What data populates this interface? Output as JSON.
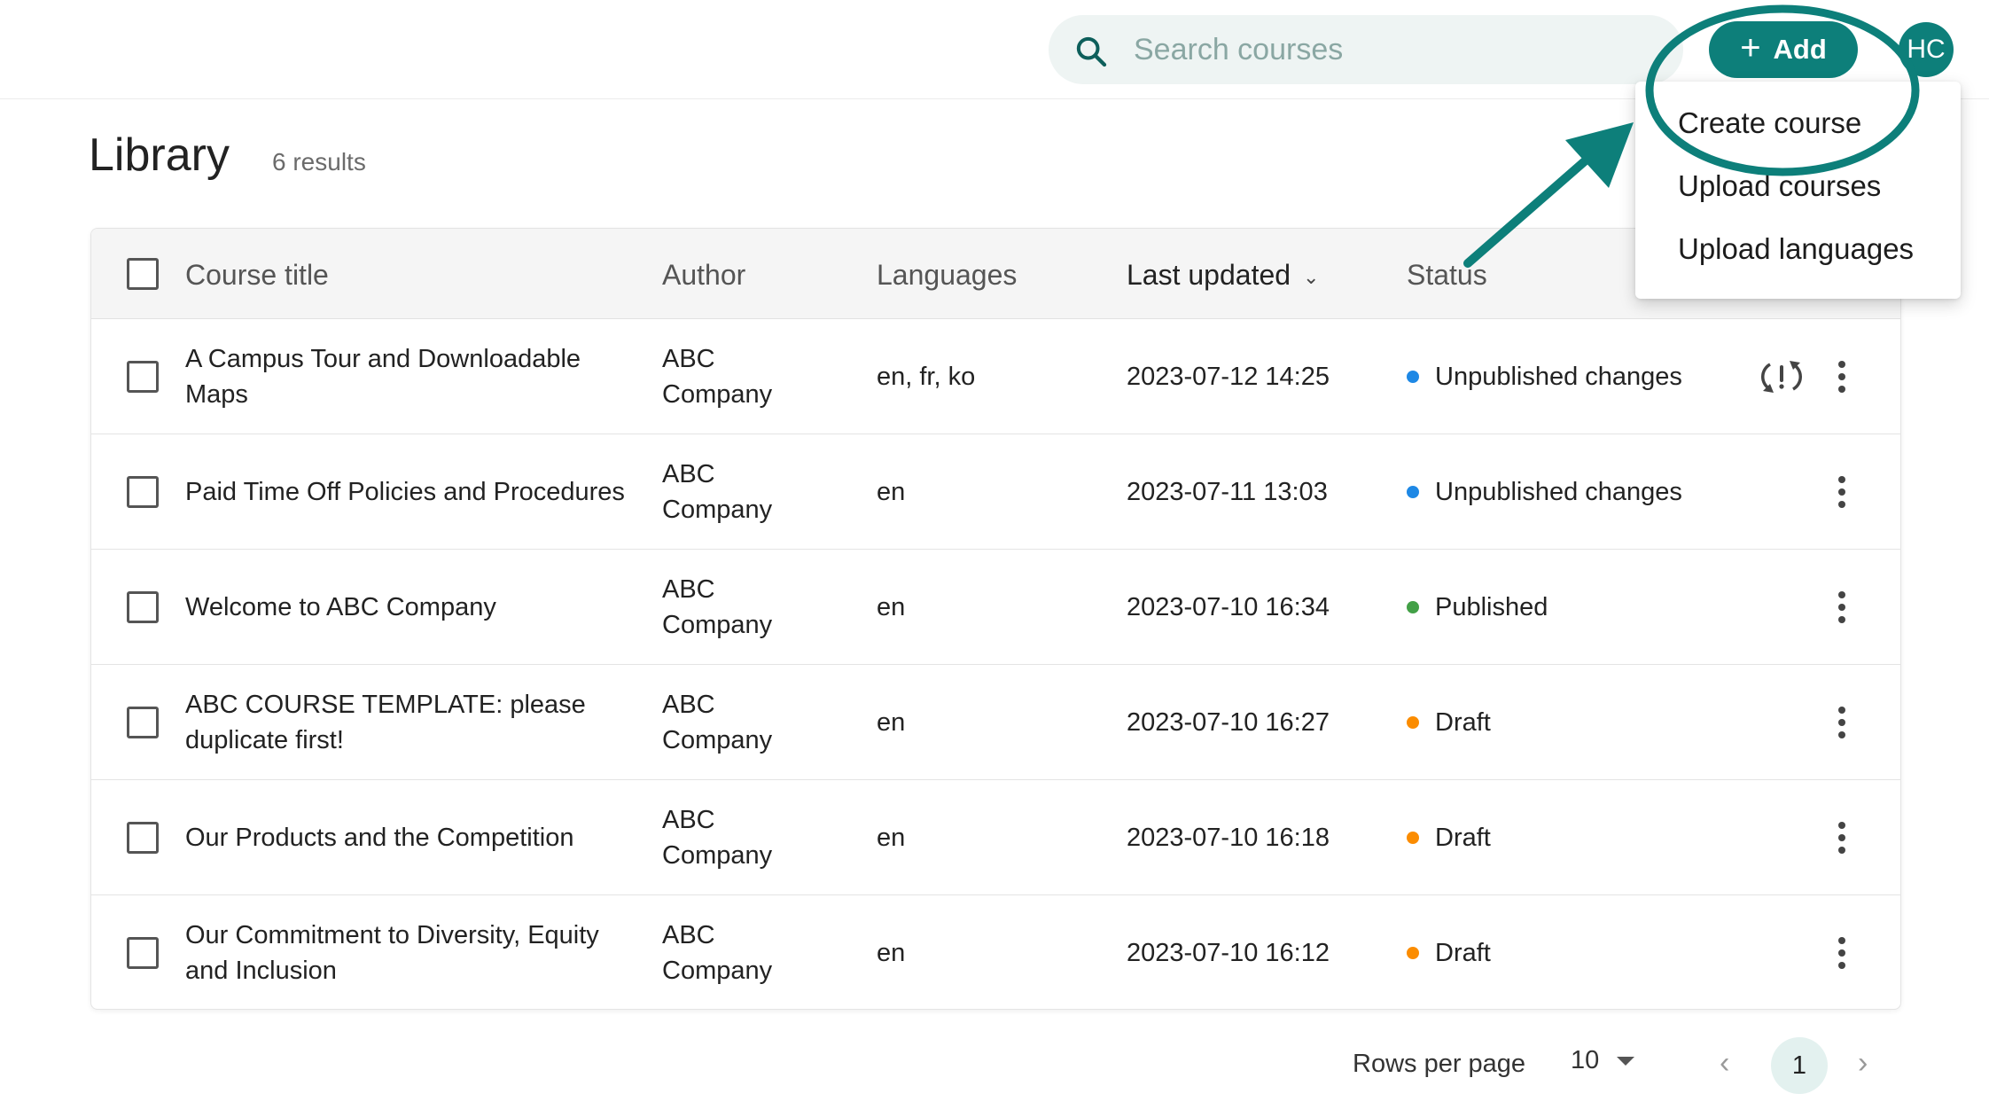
{
  "search": {
    "placeholder": "Search courses"
  },
  "header": {
    "add_label": "Add",
    "avatar_initials": "HC"
  },
  "add_menu": {
    "items": [
      "Create course",
      "Upload courses",
      "Upload languages"
    ]
  },
  "page": {
    "title": "Library",
    "results": "6 results"
  },
  "table": {
    "columns": [
      "Course title",
      "Author",
      "Languages",
      "Last updated",
      "Status"
    ],
    "rows": [
      {
        "title": "A Campus Tour and Downloadable Maps",
        "author": "ABC Company",
        "languages": "en, fr, ko",
        "updated": "2023-07-12 14:25",
        "status": "Unpublished changes",
        "status_color": "#1e88e5",
        "sync_icon": true
      },
      {
        "title": "Paid Time Off Policies and Procedures",
        "author": "ABC Company",
        "languages": "en",
        "updated": "2023-07-11 13:03",
        "status": "Unpublished changes",
        "status_color": "#1e88e5"
      },
      {
        "title": "Welcome to ABC Company",
        "author": "ABC Company",
        "languages": "en",
        "updated": "2023-07-10 16:34",
        "status": "Published",
        "status_color": "#43a047"
      },
      {
        "title": "ABC COURSE TEMPLATE: please duplicate first!",
        "author": "ABC Company",
        "languages": "en",
        "updated": "2023-07-10 16:27",
        "status": "Draft",
        "status_color": "#fb8c00"
      },
      {
        "title": "Our Products and the Competition",
        "author": "ABC Company",
        "languages": "en",
        "updated": "2023-07-10 16:18",
        "status": "Draft",
        "status_color": "#fb8c00"
      },
      {
        "title": "Our Commitment to Diversity, Equity and Inclusion",
        "author": "ABC Company",
        "languages": "en",
        "updated": "2023-07-10 16:12",
        "status": "Draft",
        "status_color": "#fb8c00"
      }
    ]
  },
  "pagination": {
    "rows_per_page_label": "Rows per page",
    "rows_per_page": "10",
    "current_page": "1"
  },
  "colors": {
    "accent": "#0d7f7a",
    "annotation": "#0d7f7a"
  }
}
